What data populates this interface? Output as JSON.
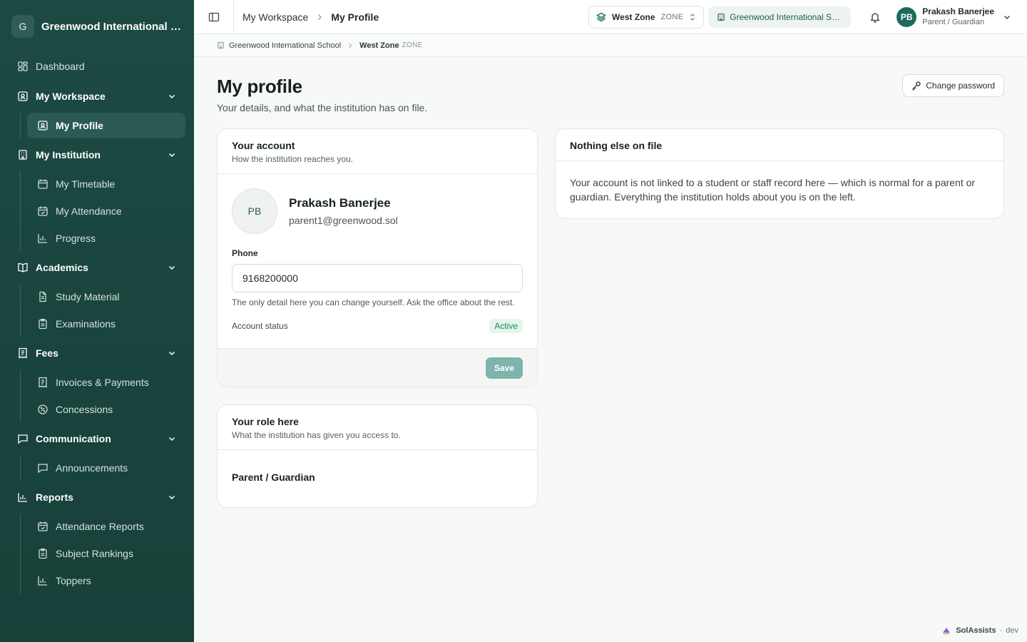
{
  "brand": {
    "initial": "G",
    "name": "Greenwood International School"
  },
  "sidebar": {
    "dashboard": "Dashboard",
    "sections": [
      {
        "label": "My Workspace",
        "items": [
          "My Profile"
        ]
      },
      {
        "label": "My Institution",
        "items": [
          "My Timetable",
          "My Attendance",
          "Progress"
        ]
      },
      {
        "label": "Academics",
        "items": [
          "Study Material",
          "Examinations"
        ]
      },
      {
        "label": "Fees",
        "items": [
          "Invoices & Payments",
          "Concessions"
        ]
      },
      {
        "label": "Communication",
        "items": [
          "Announcements"
        ]
      },
      {
        "label": "Reports",
        "items": [
          "Attendance Reports",
          "Subject Rankings",
          "Toppers"
        ]
      }
    ]
  },
  "topbar": {
    "breadcrumb": [
      "My Workspace",
      "My Profile"
    ],
    "zone_name": "West Zone",
    "zone_tag": "ZONE",
    "school": "Greenwood International School",
    "user": {
      "initials": "PB",
      "name": "Prakash Banerjee",
      "role": "Parent / Guardian"
    }
  },
  "subcrumb": {
    "school": "Greenwood International School",
    "zone": "West Zone",
    "zone_tag": "ZONE"
  },
  "page": {
    "title": "My profile",
    "subtitle": "Your details, and what the institution has on file.",
    "change_password": "Change password"
  },
  "account_card": {
    "title": "Your account",
    "desc": "How the institution reaches you.",
    "initials": "PB",
    "name": "Prakash Banerjee",
    "email": "parent1@greenwood.sol",
    "phone_label": "Phone",
    "phone_value": "9168200000",
    "hint": "The only detail here you can change yourself. Ask the office about the rest.",
    "status_label": "Account status",
    "status_value": "Active",
    "save": "Save"
  },
  "role_card": {
    "title": "Your role here",
    "desc": "What the institution has given you access to.",
    "role": "Parent / Guardian"
  },
  "nothing_card": {
    "title": "Nothing else on file",
    "text": "Your account is not linked to a student or staff record here — which is normal for a parent or guardian. Everything the institution holds about you is on the left."
  },
  "footer": {
    "brand": "SolAssists",
    "env": "dev"
  },
  "colors": {
    "sidebar": "#1c4a43",
    "accent": "#1c6b5e",
    "active_badge": "#1c8a55"
  }
}
